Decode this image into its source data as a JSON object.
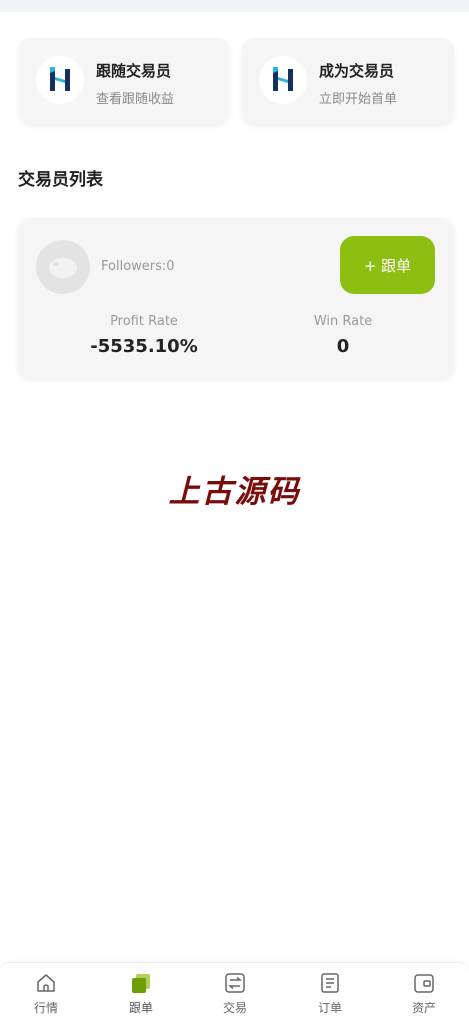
{
  "feature_cards": [
    {
      "title": "跟随交易员",
      "subtitle": "查看跟随收益",
      "icon": "brand-logo-icon"
    },
    {
      "title": "成为交易员",
      "subtitle": "立即开始首单",
      "icon": "brand-logo-icon"
    }
  ],
  "section_title": "交易员列表",
  "trader": {
    "followers": "Followers:0",
    "follow_button": "+ 跟单",
    "profit_rate_label": "Profit Rate",
    "profit_rate_value": "-5535.10%",
    "win_rate_label": "Win Rate",
    "win_rate_value": "0"
  },
  "watermark": "上古源码",
  "bottom_nav": [
    {
      "label": "行情",
      "icon": "home-icon",
      "active": false
    },
    {
      "label": "跟单",
      "icon": "copy-trade-icon",
      "active": true
    },
    {
      "label": "交易",
      "icon": "exchange-icon",
      "active": false
    },
    {
      "label": "订单",
      "icon": "order-list-icon",
      "active": false
    },
    {
      "label": "资产",
      "icon": "wallet-icon",
      "active": false
    }
  ],
  "colors": {
    "accent": "#8cbf12",
    "watermark": "#7a0b0b",
    "card_bg": "#f5f5f5",
    "logo_dark": "#15305e",
    "logo_cyan": "#27b6e0"
  }
}
